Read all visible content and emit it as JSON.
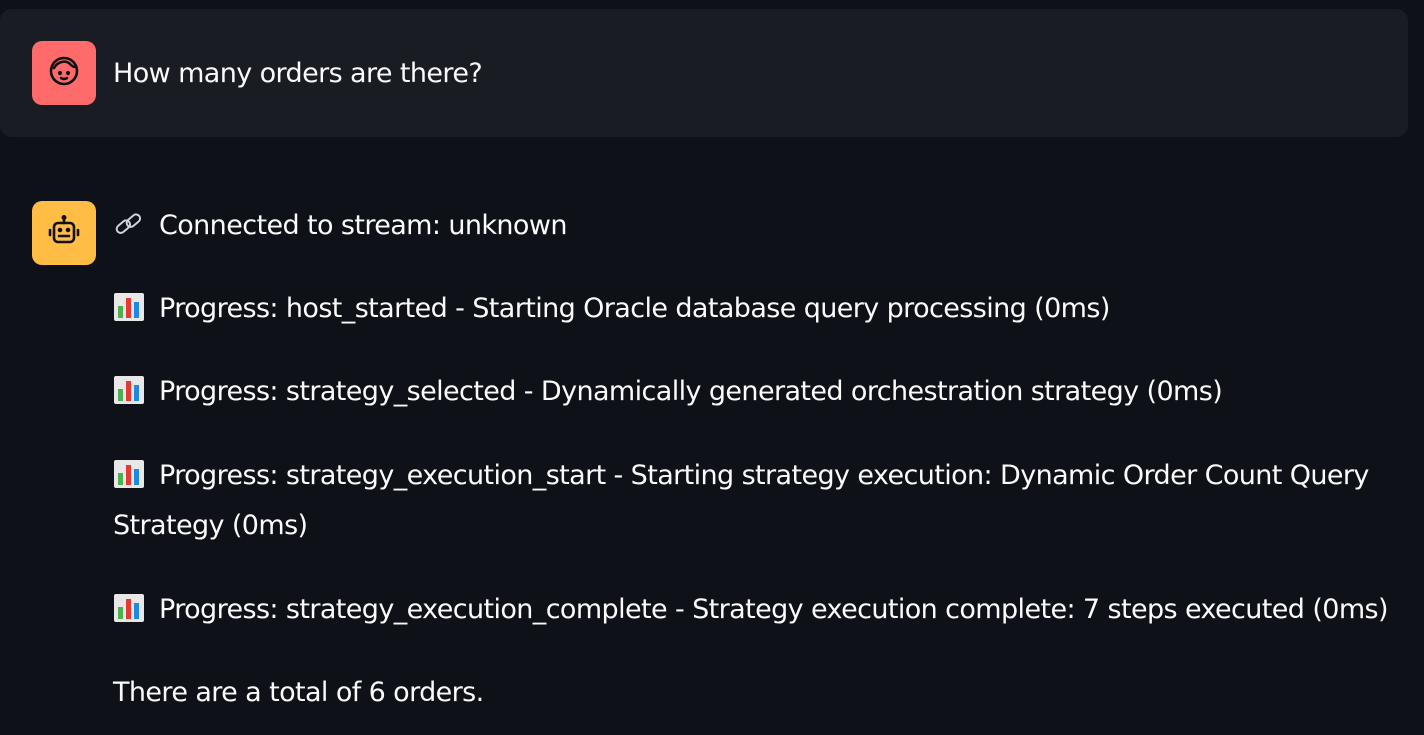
{
  "user_message": {
    "avatar_icon": "face-icon",
    "text": "How many orders are there?"
  },
  "assistant_message": {
    "avatar_icon": "robot-icon",
    "stream_line": {
      "icon": "link-icon",
      "text": "Connected to stream: unknown"
    },
    "progress_lines": [
      {
        "icon": "bar-chart-icon",
        "text": "Progress: host_started - Starting Oracle database query processing (0ms)"
      },
      {
        "icon": "bar-chart-icon",
        "text": "Progress: strategy_selected - Dynamically generated orchestration strategy (0ms)"
      },
      {
        "icon": "bar-chart-icon",
        "text": "Progress: strategy_execution_start - Starting strategy execution: Dynamic Order Count Query Strategy (0ms)"
      },
      {
        "icon": "bar-chart-icon",
        "text": "Progress: strategy_execution_complete - Strategy execution complete: 7 steps executed (0ms)"
      }
    ],
    "answer": "There are a total of 6 orders."
  },
  "colors": {
    "background": "#0e1117",
    "user_bubble": "#1a1c24",
    "user_avatar": "#ff6b6b",
    "assistant_avatar": "#ffbd45",
    "text": "#fafafa"
  }
}
